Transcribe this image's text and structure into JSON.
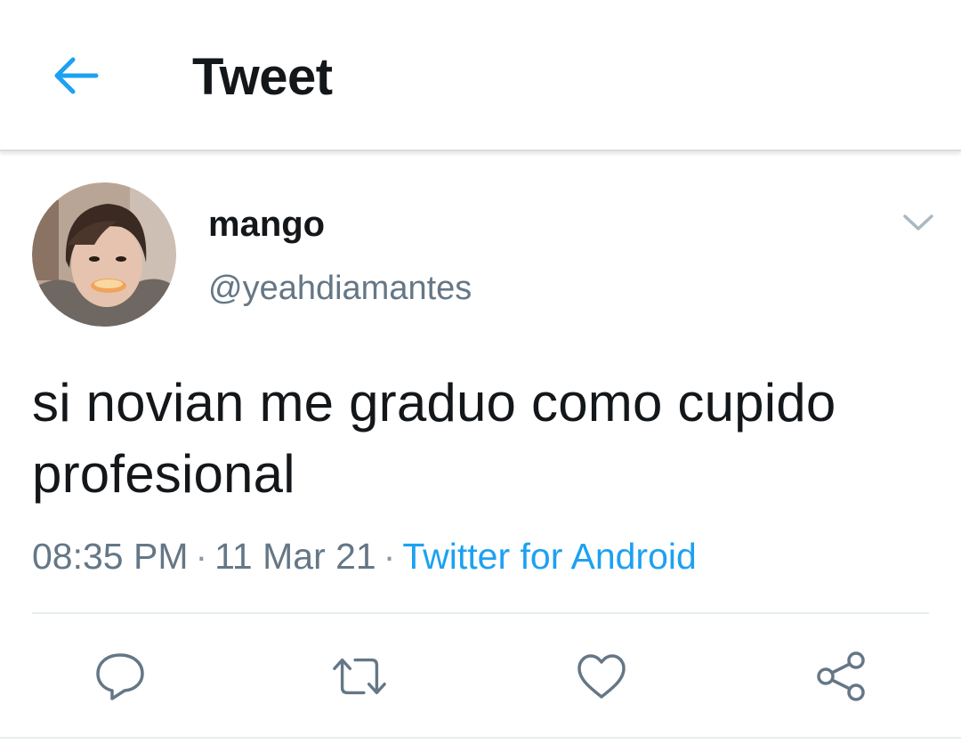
{
  "header": {
    "title": "Tweet",
    "back_icon": "arrow-left-icon"
  },
  "tweet": {
    "display_name": "mango",
    "handle": "@yeahdiamantes",
    "text": "si novian me graduo como cupido profesional",
    "time": "08:35 PM",
    "separator": "·",
    "date": "11 Mar 21",
    "source": "Twitter for Android"
  },
  "actions": {
    "reply_icon": "reply-icon",
    "retweet_icon": "retweet-icon",
    "like_icon": "heart-icon",
    "share_icon": "share-icon"
  },
  "colors": {
    "accent": "#1da1f2",
    "text": "#14171a",
    "secondary": "#657786",
    "divider": "#e6ecf0"
  }
}
